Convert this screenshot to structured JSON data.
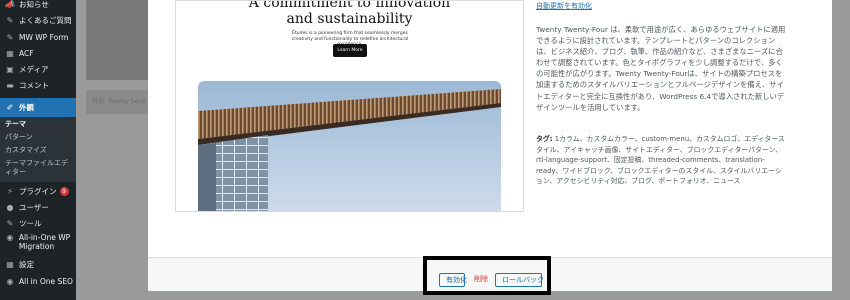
{
  "sidebar": {
    "items": [
      {
        "icon": "megaphone-icon",
        "glyph": "📣",
        "label": "お知らせ"
      },
      {
        "icon": "pin-icon",
        "glyph": "✎",
        "label": "よくあるご質問"
      },
      {
        "icon": "pin-icon",
        "glyph": "✎",
        "label": "MW WP Form"
      },
      {
        "icon": "acf-icon",
        "glyph": "▦",
        "label": "ACF"
      },
      {
        "icon": "media-icon",
        "glyph": "▣",
        "label": "メディア"
      },
      {
        "icon": "comment-icon",
        "glyph": "▬",
        "label": "コメント"
      },
      {
        "icon": "appearance-icon",
        "glyph": "✐",
        "label": "外観"
      },
      {
        "icon": "plugin-icon",
        "glyph": "⚡",
        "label": "プラグイン",
        "badge": "9"
      },
      {
        "icon": "users-icon",
        "glyph": "●",
        "label": "ユーザー"
      },
      {
        "icon": "tools-icon",
        "glyph": "✎",
        "label": "ツール"
      },
      {
        "icon": "aioseo-icon",
        "glyph": "◉",
        "label": "All-in-One WP Migration"
      },
      {
        "icon": "settings-icon",
        "glyph": "▦",
        "label": "設定"
      },
      {
        "icon": "aioseo-icon",
        "glyph": "◉",
        "label": "All in One SEO"
      }
    ],
    "submenu": [
      "テーマ",
      "パターン",
      "カスタマイズ",
      "テーマファイルエディター"
    ]
  },
  "background": {
    "theme_label": "有効: Twenty Seve"
  },
  "preview": {
    "headline_line1": "A commitment to innovation",
    "headline_line2": "and sustainability",
    "intro": "Études is a pioneering firm that seamlessly merges creativity and functionality to redefine architectural excellence.",
    "button": "Learn More"
  },
  "details": {
    "auto_update_link": "自動更新を有効化",
    "description": "Twenty Twenty-Four は、柔軟で用途が広く、あらゆるウェブサイトに適用できるように設計されています。テンプレートとパターンのコレクションは、ビジネス紹介、ブログ、執筆、作品の紹介など、さまざまなニーズに合わせて調整されています。色とタイポグラフィを少し調整するだけで、多くの可能性が広がります。Twenty Twenty-Fourは、サイトの構築プロセスを加速するためのスタイルバリエーションとフルページデザインを備え、サイトエディターと完全に互換性があり、WordPress 6.4で導入された新しいデザインツールを活用しています。",
    "tags_label": "タグ:",
    "tags": "1カラム、カスタムカラー、custom-menu、カスタムロゴ、エディタースタイル、アイキャッチ画像、サイトエディター、ブロックエディターパターン、rtl-language-support、固定投稿、threaded-comments、translation-ready、ワイドブロック、ブロックエディターのスタイル、スタイルバリエーション、アクセシビリティ対応、ブログ、ポートフォリオ、ニュース"
  },
  "footer": {
    "activate": "有効化",
    "delete": "削除",
    "rollback": "ロールバック"
  },
  "colors": {
    "sidebar_bg": "#1d2327",
    "accent": "#2271b1",
    "danger": "#d63638"
  }
}
